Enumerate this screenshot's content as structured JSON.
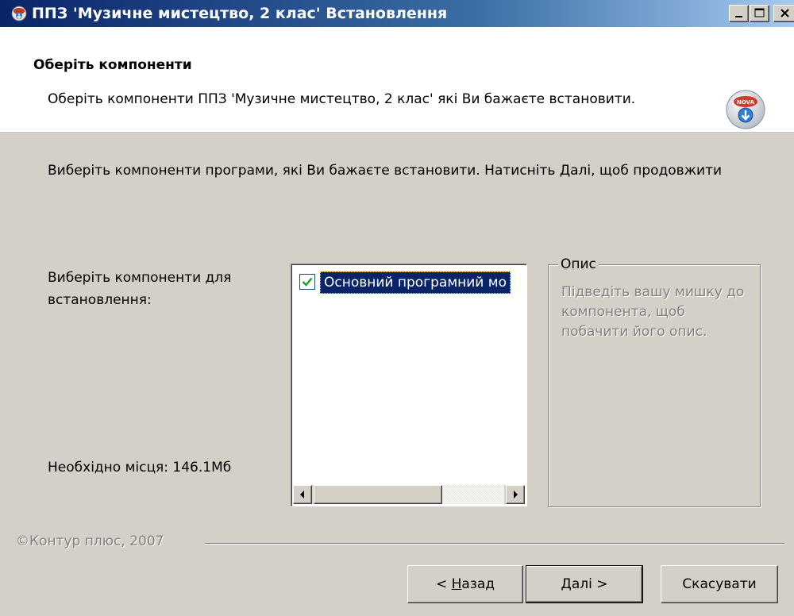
{
  "window": {
    "title": "ППЗ 'Музичне мистецтво, 2 клас' Встановлення",
    "icon": "installer-globe-icon",
    "controls": [
      "minimize-icon",
      "maximize-icon",
      "close-icon"
    ]
  },
  "header": {
    "title": "Оберіть компоненти",
    "subtitle": "Оберіть компоненти ППЗ 'Музичне мистецтво, 2 клас' які Ви бажаєте встановити.",
    "logo": "nova-install-icon"
  },
  "body": {
    "intro": "Виберіть компоненти програми, які Ви бажаєте встановити. Натисніть Далі, щоб продовжити",
    "components_label": "Виберіть компоненти для встановлення:",
    "space_required": "Необхідно місця: 146.1Мб",
    "components": [
      {
        "label": "Основний програмний мо",
        "checked": true,
        "selected": true
      }
    ],
    "description": {
      "legend": "Опис",
      "text": "Підведіть вашу мишку до компонента, щоб побачити його опис."
    }
  },
  "footer": {
    "branding": "©Контур плюс, 2007",
    "back_prefix": "< ",
    "back_accel": "Н",
    "back_rest": "азад",
    "next_accel": "Д",
    "next_rest": "алі >",
    "cancel": "Скасувати"
  },
  "colors": {
    "face": "#d4d0c8",
    "selection": "#0a246a",
    "title_gradient_start": "#0a246a",
    "title_gradient_end": "#a6caf0",
    "check_mark": "#21a121"
  }
}
